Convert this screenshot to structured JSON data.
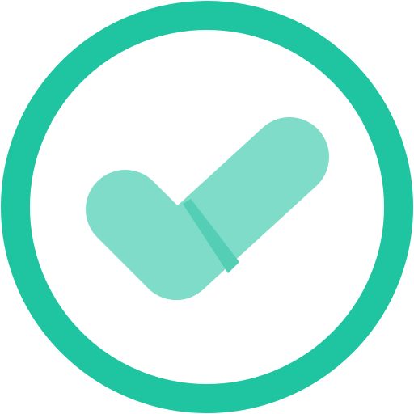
{
  "icon": {
    "name": "check-circle-icon",
    "colors": {
      "ring": "#1FC4A0",
      "background": "#FFFFFF",
      "check_light": "#7EDCC9",
      "check_mid": "#54CFB5",
      "check_dark": "#19B697"
    }
  }
}
